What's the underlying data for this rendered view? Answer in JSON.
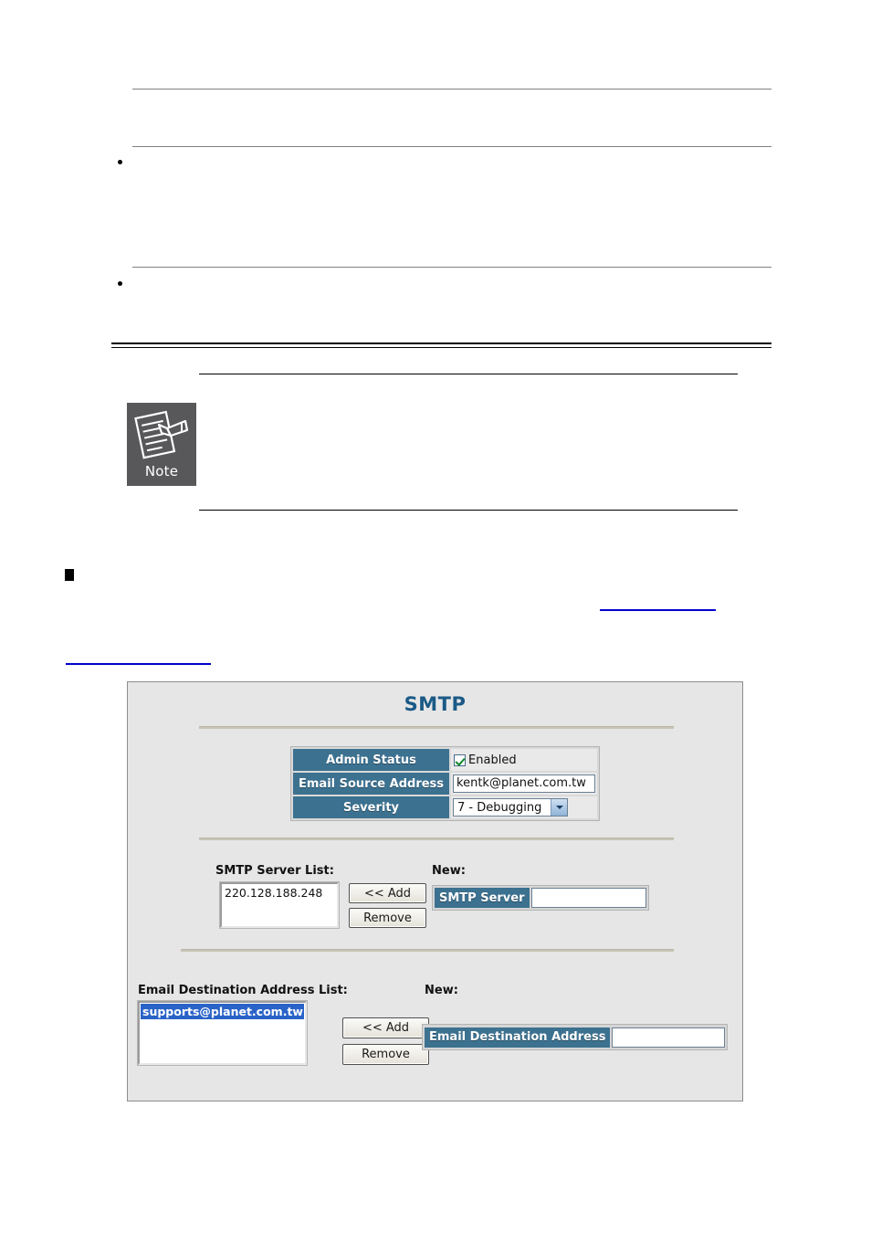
{
  "document": {
    "note_callout": {
      "icon": "note-pad-pen-icon",
      "label": "Note"
    },
    "bullets": [
      "bullet-dot",
      "bullet-dot",
      "bullet-square"
    ],
    "links": [
      "cross-reference-link",
      "cross-reference-link"
    ]
  },
  "smtp_panel": {
    "title": "SMTP",
    "settings": {
      "rows": [
        {
          "label": "Admin Status",
          "control": "checkbox",
          "checked": true,
          "value": "Enabled"
        },
        {
          "label": "Email Source Address",
          "control": "text",
          "value": "kentk@planet.com.tw"
        },
        {
          "label": "Severity",
          "control": "select",
          "value": "7 - Debugging"
        }
      ]
    },
    "server_section": {
      "list_label": "SMTP Server List:",
      "new_label": "New:",
      "items": [
        "220.128.188.248"
      ],
      "add_button": "<< Add",
      "remove_button": "Remove",
      "field_label": "SMTP Server",
      "field_value": ""
    },
    "destination_section": {
      "list_label": "Email Destination Address List:",
      "new_label": "New:",
      "items": [
        "supports@planet.com.tw"
      ],
      "selected_index": 0,
      "add_button": "<< Add",
      "remove_button": "Remove",
      "field_label": "Email Destination Address",
      "field_value": ""
    }
  },
  "colors": {
    "header_blue": "#3c7190",
    "title_blue": "#1b5a87",
    "selection_blue": "#2a63c8",
    "panel_bg": "#e6e6e6",
    "note_bg": "#58585a",
    "link_blue": "#0000cc",
    "separator": "#c8c4b6"
  }
}
